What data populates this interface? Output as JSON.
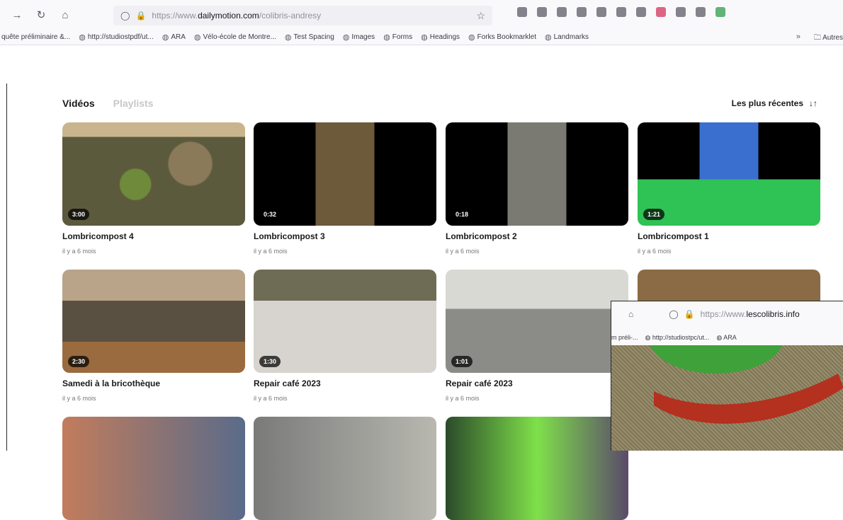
{
  "browser": {
    "url_scheme": "https://www.",
    "url_host": "dailymotion.com",
    "url_path": "/colibris-andresy",
    "bookmarks": [
      "quête préliminaire &...",
      "http://studiostpdf/ut...",
      "ARA",
      "Vélo-école de Montre...",
      "Test Spacing",
      "Images",
      "Forms",
      "Headings",
      "Forks Bookmarklet",
      "Landmarks"
    ],
    "bookmarks_more": "»",
    "bookmarks_folder": "Autres"
  },
  "tabs": {
    "videos": "Vidéos",
    "playlists": "Playlists"
  },
  "sort": {
    "label": "Les plus récentes",
    "icon": "sort-icon"
  },
  "videos": [
    {
      "title": "Lombricompost 4",
      "duration": "3:00",
      "age": "il y a 6 mois"
    },
    {
      "title": "Lombricompost 3",
      "duration": "0:32",
      "age": "il y a 6 mois"
    },
    {
      "title": "Lombricompost 2",
      "duration": "0:18",
      "age": "il y a 6 mois"
    },
    {
      "title": "Lombricompost 1",
      "duration": "1:21",
      "age": "il y a 6 mois"
    },
    {
      "title": "Samedi à la bricothèque",
      "duration": "2:30",
      "age": "il y a 6 mois"
    },
    {
      "title": "Repair café 2023",
      "duration": "1:30",
      "age": "il y a 6 mois"
    },
    {
      "title": "Repair café 2023",
      "duration": "1:01",
      "age": "il y a 6 mois"
    }
  ],
  "overlay": {
    "url_scheme": "https://www.",
    "url_host": "lescolibris.info",
    "bookmarks": [
      "m préli-...",
      "http://studiostpc/ut...",
      "ARA"
    ]
  }
}
